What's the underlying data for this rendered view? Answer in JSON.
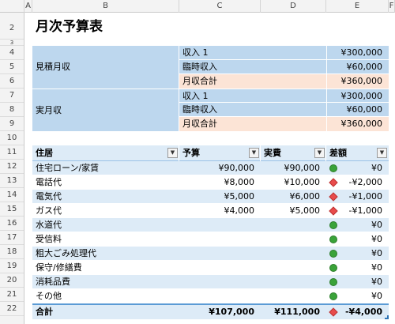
{
  "columns": [
    "A",
    "B",
    "C",
    "D",
    "E",
    "F"
  ],
  "rows": [
    "2",
    "3",
    "4",
    "5",
    "6",
    "7",
    "8",
    "9",
    "10",
    "11",
    "12",
    "13",
    "14",
    "15",
    "16",
    "17",
    "18",
    "19",
    "20",
    "21",
    "22"
  ],
  "title": "月次予算表",
  "estimate": {
    "label": "見積月収",
    "items": [
      {
        "name": "収入 1",
        "value": "¥300,000"
      },
      {
        "name": "臨時収入",
        "value": "¥60,000"
      },
      {
        "name": "月収合計",
        "value": "¥360,000"
      }
    ]
  },
  "actual": {
    "label": "実月収",
    "items": [
      {
        "name": "収入 1",
        "value": "¥300,000"
      },
      {
        "name": "臨時収入",
        "value": "¥60,000"
      },
      {
        "name": "月収合計",
        "value": "¥360,000"
      }
    ]
  },
  "table": {
    "headers": [
      "住居",
      "予算",
      "実費",
      "差額"
    ],
    "rows": [
      {
        "item": "住宅ローン/家賃",
        "budget": "¥90,000",
        "actual": "¥90,000",
        "diff": "¥0",
        "status": "ok"
      },
      {
        "item": "電話代",
        "budget": "¥8,000",
        "actual": "¥10,000",
        "diff": "-¥2,000",
        "status": "over"
      },
      {
        "item": "電気代",
        "budget": "¥5,000",
        "actual": "¥6,000",
        "diff": "-¥1,000",
        "status": "over"
      },
      {
        "item": "ガス代",
        "budget": "¥4,000",
        "actual": "¥5,000",
        "diff": "-¥1,000",
        "status": "over"
      },
      {
        "item": "水道代",
        "budget": "",
        "actual": "",
        "diff": "¥0",
        "status": "ok"
      },
      {
        "item": "受信料",
        "budget": "",
        "actual": "",
        "diff": "¥0",
        "status": "ok"
      },
      {
        "item": "粗大ごみ処理代",
        "budget": "",
        "actual": "",
        "diff": "¥0",
        "status": "ok"
      },
      {
        "item": "保守/修繕費",
        "budget": "",
        "actual": "",
        "diff": "¥0",
        "status": "ok"
      },
      {
        "item": "消耗品費",
        "budget": "",
        "actual": "",
        "diff": "¥0",
        "status": "ok"
      },
      {
        "item": "その他",
        "budget": "",
        "actual": "",
        "diff": "¥0",
        "status": "ok"
      }
    ],
    "total": {
      "label": "合計",
      "budget": "¥107,000",
      "actual": "¥111,000",
      "diff": "-¥4,000",
      "status": "over"
    }
  },
  "colors": {
    "header_band": "#bdd7ee",
    "light_band": "#ddebf7",
    "highlight": "#fce4d6",
    "ok": "#3aa339",
    "over": "#e84c4c"
  }
}
